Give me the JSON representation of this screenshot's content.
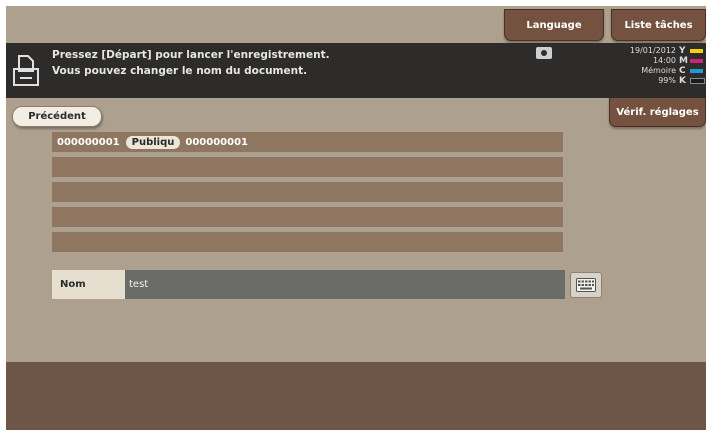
{
  "topbar": {
    "language_label": "Language",
    "tasks_label": "Liste tâches"
  },
  "message": {
    "line1": "Pressez [Départ] pour lancer l'enregistrement.",
    "line2": "Vous pouvez changer le nom du document."
  },
  "status": {
    "date": "19/01/2012",
    "time": "14:00",
    "memory_label": "Mémoire",
    "memory_value": "99%"
  },
  "toner": [
    {
      "label": "Y",
      "color": "#f2d200"
    },
    {
      "label": "M",
      "color": "#d0207a"
    },
    {
      "label": "C",
      "color": "#1f9ad6"
    },
    {
      "label": "K",
      "color": "#1b1b1b"
    }
  ],
  "nav": {
    "previous_label": "Précédent",
    "verify_label": "Vérif. réglages"
  },
  "path": {
    "box": "000000001",
    "type": "Publiqu",
    "folder": "000000001"
  },
  "name": {
    "label": "Nom",
    "value": "test"
  }
}
